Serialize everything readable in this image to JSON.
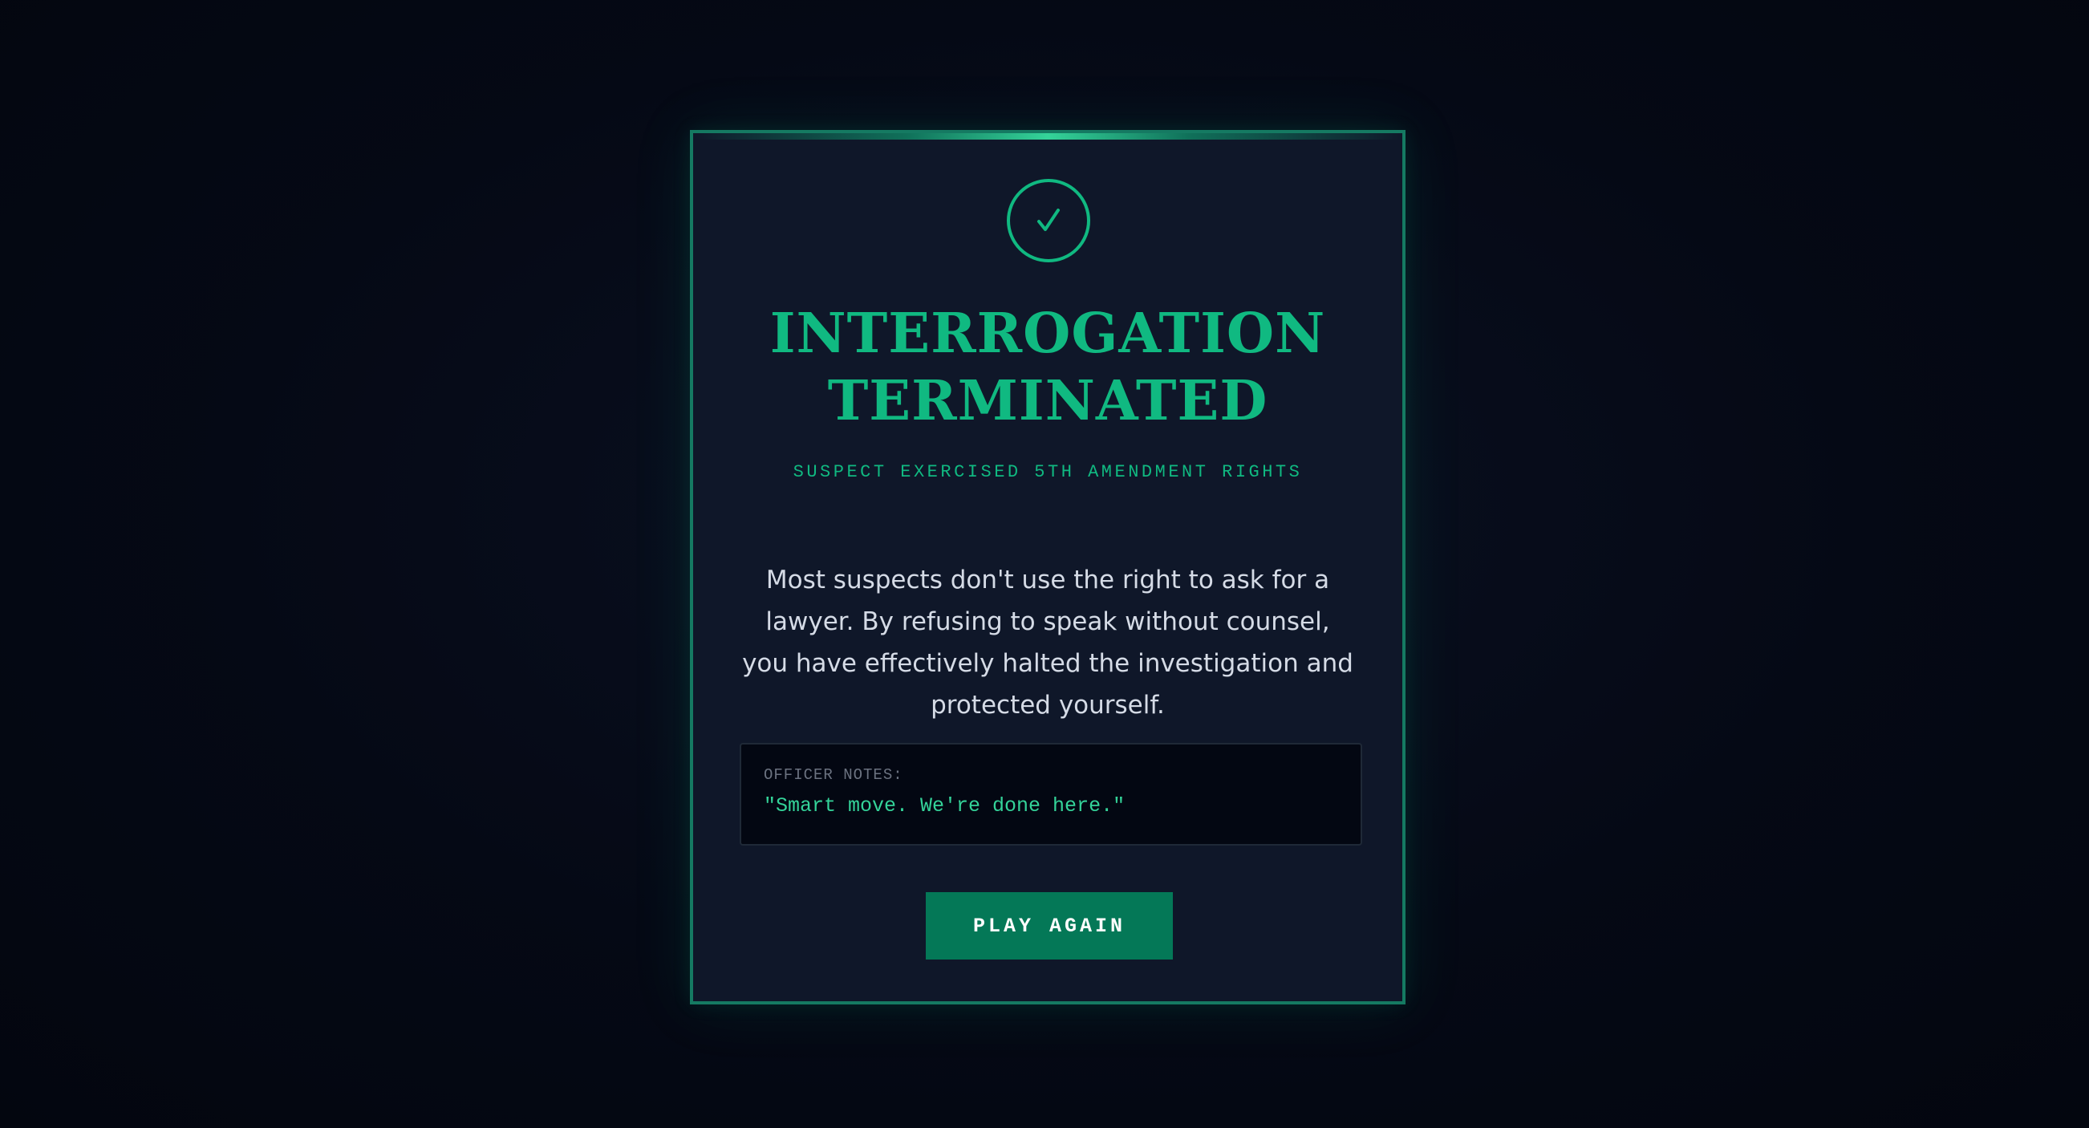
{
  "modal": {
    "icon": "checkmark-icon",
    "title_line1": "INTERROGATION",
    "title_line2": "TERMINATED",
    "subtitle": "SUSPECT EXERCISED 5TH AMENDMENT RIGHTS",
    "message": "Most suspects don't use the right to ask for a lawyer. By refusing to speak without counsel, you have effectively halted the investigation and protected yourself.",
    "notes_label": "OFFICER NOTES:",
    "notes_quote": "\"Smart move. We're done here.\"",
    "button_label": "PLAY AGAIN"
  },
  "colors": {
    "background": "#050915",
    "card": "#0f1729",
    "accent": "#10b981",
    "button": "#047857",
    "notes_bg": "#030712"
  }
}
